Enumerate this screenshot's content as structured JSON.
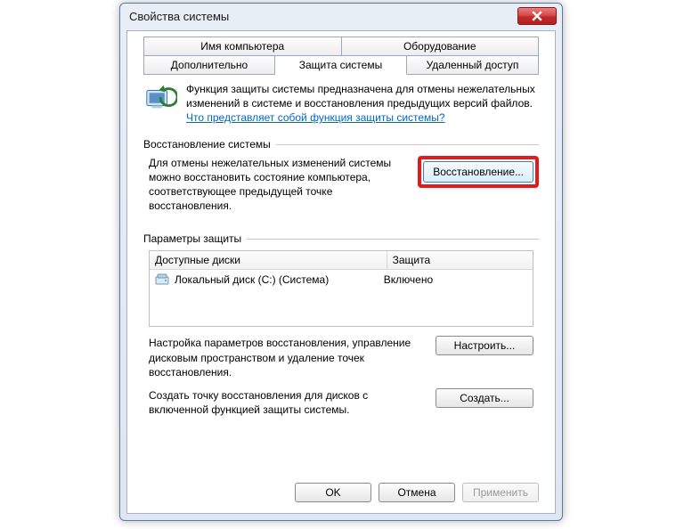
{
  "window": {
    "title": "Свойства системы"
  },
  "tabs": {
    "row1": [
      "Имя компьютера",
      "Оборудование"
    ],
    "row2": [
      "Дополнительно",
      "Защита системы",
      "Удаленный доступ"
    ],
    "active": "Защита системы"
  },
  "intro": {
    "text": "Функция защиты системы предназначена для отмены нежелательных изменений в системе и восстановления предыдущих версий файлов. ",
    "link": "Что представляет собой функция защиты системы?"
  },
  "restore": {
    "group": "Восстановление системы",
    "text": "Для отмены нежелательных изменений системы можно восстановить состояние компьютера, соответствующее предыдущей точке восстановления.",
    "button": "Восстановление..."
  },
  "params": {
    "group": "Параметры защиты",
    "headers": {
      "disks": "Доступные диски",
      "protection": "Защита"
    },
    "rows": [
      {
        "name": "Локальный диск (C:) (Система)",
        "protection": "Включено"
      }
    ],
    "configure_text": "Настройка параметров восстановления, управление дисковым пространством и удаление точек восстановления.",
    "configure_button": "Настроить...",
    "create_text": "Создать точку восстановления для дисков с включенной функцией защиты системы.",
    "create_button": "Создать..."
  },
  "footer": {
    "ok": "OK",
    "cancel": "Отмена",
    "apply": "Применить"
  }
}
